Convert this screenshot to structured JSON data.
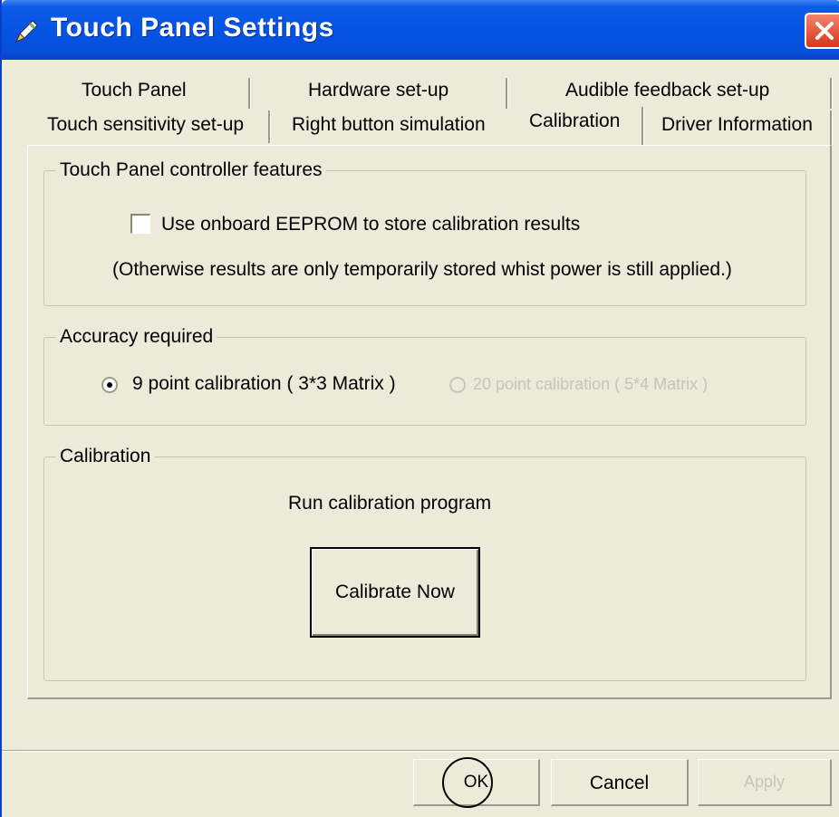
{
  "window": {
    "title": "Touch Panel Settings",
    "icon": "pen-icon",
    "close_icon": "close-icon"
  },
  "tabs": {
    "row1": [
      "Touch Panel",
      "Hardware set-up",
      "Audible feedback set-up"
    ],
    "row2": [
      "Touch sensitivity set-up",
      "Right button simulation",
      "Calibration",
      "Driver Information"
    ],
    "active": "Calibration"
  },
  "controller": {
    "legend": "Touch Panel controller features",
    "checkbox_label": "Use onboard EEPROM to store calibration results",
    "checkbox_checked": false,
    "note": "(Otherwise results are only temporarily stored whist power is still applied.)"
  },
  "accuracy": {
    "legend": "Accuracy required",
    "option1": "9 point calibration ( 3*3 Matrix )",
    "option1_selected": true,
    "option2": "20 point calibration ( 5*4 Matrix )",
    "option2_enabled": false
  },
  "calibration": {
    "legend": "Calibration",
    "caption": "Run calibration program",
    "button": "Calibrate Now"
  },
  "buttons": {
    "ok": "OK",
    "cancel": "Cancel",
    "apply": "Apply",
    "apply_enabled": false
  },
  "colors": {
    "titlebar": "#0654e4",
    "dialog_bg": "#ecead9",
    "close_button": "#d6361b"
  }
}
